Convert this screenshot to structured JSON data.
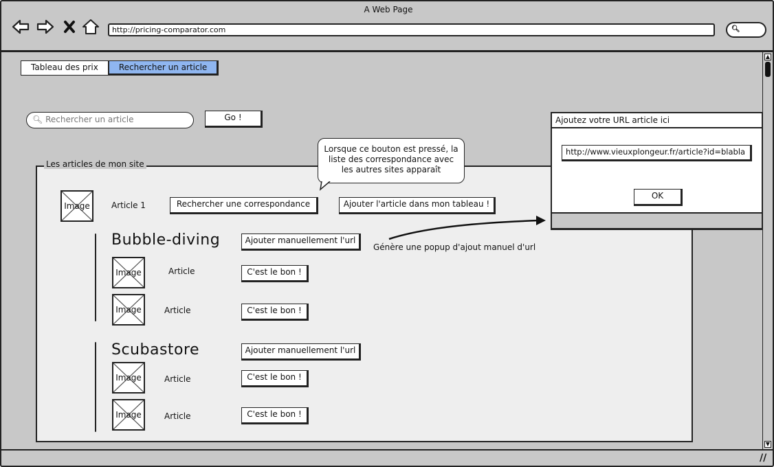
{
  "window": {
    "title": "A Web Page"
  },
  "browser": {
    "url": "http://pricing-comparator.com",
    "nav_icons": [
      "back-arrow-icon",
      "forward-arrow-icon",
      "close-x-icon",
      "home-icon"
    ],
    "search_icon": "magnifier-icon"
  },
  "tabs": [
    {
      "label": "Tableau des prix",
      "active": false
    },
    {
      "label": "Rechercher un article",
      "active": true
    }
  ],
  "search": {
    "placeholder": "Rechercher un article",
    "go_label": "Go !"
  },
  "my_articles": {
    "legend": "Les articles de mon site",
    "article": {
      "image_label": "Image",
      "name": "Article 1",
      "match_button": "Rechercher une correspondance",
      "add_button": "Ajouter l'article dans mon tableau !"
    }
  },
  "callout": {
    "text": "Lorsque ce bouton est pressé, la liste des correspondance avec les autres sites apparaît"
  },
  "annotation": "Génère une popup d'ajout manuel d'url",
  "sites": [
    {
      "name": "Bubble-diving",
      "manual_button": "Ajouter manuellement l'url",
      "results": [
        {
          "image_label": "Image",
          "name": "Article",
          "button": "C'est le bon !"
        },
        {
          "image_label": "Image",
          "name": "Article",
          "button": "C'est le bon !"
        }
      ]
    },
    {
      "name": "Scubastore",
      "manual_button": "Ajouter manuellement l'url",
      "results": [
        {
          "image_label": "Image",
          "name": "Article",
          "button": "C'est le bon !"
        },
        {
          "image_label": "Image",
          "name": "Article",
          "button": "C'est le bon !"
        }
      ]
    }
  ],
  "popup": {
    "title": "Ajoutez votre URL article ici",
    "url_value": "http://www.vieuxplongeur.fr/article?id=blabla",
    "ok_label": "OK"
  },
  "colors": {
    "active_tab": "#8fb6f0",
    "background": "#c8c8c8",
    "panel": "#eeeeee"
  }
}
